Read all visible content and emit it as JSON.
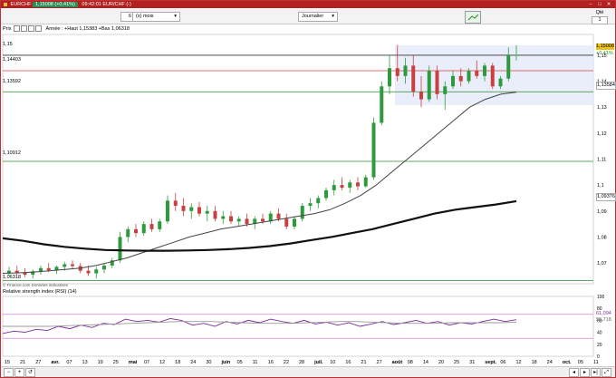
{
  "titlebar": {
    "symbol": "EURCHF",
    "change": "1,15008 (+0,41%)",
    "time_instrument": "09:42:01 EUR/CHF (-)",
    "min_btn": "–",
    "max_btn": "□",
    "close_btn": "✕"
  },
  "toolbar": {
    "period_value": "6",
    "period_unit": "(x) mois",
    "interval": "Journalier",
    "qte_label": "Qté",
    "qte_value": "1"
  },
  "main_panel": {
    "label": "Prix",
    "ohlc_text": "Année : +Haut 1,15383 +Bas 1,06318",
    "level_labels": [
      "1,15",
      "1,14403",
      "1,13592",
      "1,10912",
      "1,06318"
    ],
    "level_line_color": "#2e8b2e",
    "level_line_color_red": "#d04040",
    "up_color": "#2e9a3e",
    "down_color": "#c84040",
    "last_price_tag": "1,15008",
    "last_change_tag": "+0,41%",
    "tag_113584": "1,13584",
    "tag_109376": "1,09376",
    "credit": "© Finance.com Données indicatives"
  },
  "rsi_panel": {
    "label": "Relative strength index (RSI) (14)",
    "rsi_tag": "61,094",
    "signal_tag": "56,718",
    "rsi_color": "#7a2a9a",
    "signal_color": "#999999"
  },
  "chart_data": {
    "type": "candlestick",
    "symbol": "EUR/CHF",
    "x_tick_labels": [
      "15",
      "21",
      "27",
      "avr.",
      "07",
      "13",
      "19",
      "25",
      "mai",
      "07",
      "12",
      "18",
      "24",
      "30",
      "juin",
      "05",
      "11",
      "16",
      "22",
      "28",
      "juil.",
      "10",
      "16",
      "21",
      "27",
      "août",
      "08",
      "14",
      "20",
      "25",
      "31",
      "sept.",
      "06",
      "12",
      "18",
      "24",
      "oct.",
      "05",
      "11"
    ],
    "y_ticks": [
      "1,15",
      "1,14",
      "1,13",
      "1,12",
      "1,11",
      "1,1",
      "1,09",
      "1,08",
      "1,07"
    ],
    "rsi_ticks": [
      "100",
      "80",
      "60",
      "40",
      "20",
      "0"
    ],
    "ylim": [
      1.062,
      1.158
    ],
    "candles": [
      [
        1.066,
        1.0685,
        1.065,
        1.067
      ],
      [
        1.067,
        1.069,
        1.0655,
        1.0662
      ],
      [
        1.0662,
        1.068,
        1.0645,
        1.0655
      ],
      [
        1.0655,
        1.0675,
        1.064,
        1.0668
      ],
      [
        1.0668,
        1.069,
        1.0655,
        1.068
      ],
      [
        1.068,
        1.07,
        1.0665,
        1.0672
      ],
      [
        1.0672,
        1.069,
        1.0658,
        1.0685
      ],
      [
        1.0685,
        1.0705,
        1.067,
        1.0695
      ],
      [
        1.0695,
        1.071,
        1.0675,
        1.0688
      ],
      [
        1.0688,
        1.07,
        1.066,
        1.067
      ],
      [
        1.067,
        1.069,
        1.065,
        1.066
      ],
      [
        1.066,
        1.0685,
        1.064,
        1.0675
      ],
      [
        1.0675,
        1.07,
        1.066,
        1.069
      ],
      [
        1.069,
        1.072,
        1.068,
        1.071
      ],
      [
        1.071,
        1.082,
        1.07,
        1.08
      ],
      [
        1.08,
        1.084,
        1.078,
        1.083
      ],
      [
        1.083,
        1.085,
        1.08,
        1.0815
      ],
      [
        1.0815,
        1.086,
        1.0805,
        1.085
      ],
      [
        1.085,
        1.087,
        1.082,
        1.083
      ],
      [
        1.083,
        1.087,
        1.082,
        1.086
      ],
      [
        1.086,
        1.096,
        1.085,
        1.094
      ],
      [
        1.094,
        1.097,
        1.09,
        1.092
      ],
      [
        1.092,
        1.095,
        1.088,
        1.09
      ],
      [
        1.09,
        1.093,
        1.087,
        1.0915
      ],
      [
        1.0915,
        1.0935,
        1.088,
        1.089
      ],
      [
        1.089,
        1.092,
        1.086,
        1.09
      ],
      [
        1.09,
        1.092,
        1.086,
        1.087
      ],
      [
        1.087,
        1.09,
        1.085,
        1.088
      ],
      [
        1.088,
        1.09,
        1.085,
        1.086
      ],
      [
        1.086,
        1.088,
        1.084,
        1.087
      ],
      [
        1.087,
        1.089,
        1.084,
        1.085
      ],
      [
        1.085,
        1.088,
        1.083,
        1.087
      ],
      [
        1.087,
        1.089,
        1.085,
        1.086
      ],
      [
        1.086,
        1.09,
        1.085,
        1.089
      ],
      [
        1.089,
        1.091,
        1.086,
        1.087
      ],
      [
        1.087,
        1.089,
        1.083,
        1.084
      ],
      [
        1.084,
        1.088,
        1.083,
        1.087
      ],
      [
        1.087,
        1.093,
        1.086,
        1.092
      ],
      [
        1.092,
        1.095,
        1.09,
        1.093
      ],
      [
        1.093,
        1.096,
        1.091,
        1.095
      ],
      [
        1.095,
        1.099,
        1.094,
        1.098
      ],
      [
        1.098,
        1.102,
        1.096,
        1.1
      ],
      [
        1.1,
        1.103,
        1.098,
        1.099
      ],
      [
        1.099,
        1.102,
        1.097,
        1.101
      ],
      [
        1.101,
        1.103,
        1.098,
        1.0995
      ],
      [
        1.0995,
        1.104,
        1.099,
        1.103
      ],
      [
        1.103,
        1.126,
        1.102,
        1.124
      ],
      [
        1.124,
        1.14,
        1.123,
        1.138
      ],
      [
        1.138,
        1.15,
        1.135,
        1.145
      ],
      [
        1.145,
        1.154,
        1.14,
        1.142
      ],
      [
        1.142,
        1.149,
        1.139,
        1.146
      ],
      [
        1.146,
        1.15,
        1.134,
        1.136
      ],
      [
        1.136,
        1.142,
        1.13,
        1.133
      ],
      [
        1.133,
        1.146,
        1.132,
        1.144
      ],
      [
        1.144,
        1.146,
        1.133,
        1.135
      ],
      [
        1.135,
        1.14,
        1.129,
        1.138
      ],
      [
        1.138,
        1.144,
        1.137,
        1.142
      ],
      [
        1.142,
        1.145,
        1.138,
        1.14
      ],
      [
        1.14,
        1.145,
        1.139,
        1.144
      ],
      [
        1.144,
        1.148,
        1.141,
        1.142
      ],
      [
        1.142,
        1.147,
        1.14,
        1.146
      ],
      [
        1.146,
        1.147,
        1.137,
        1.138
      ],
      [
        1.138,
        1.142,
        1.137,
        1.141
      ],
      [
        1.141,
        1.153,
        1.14,
        1.15
      ],
      [
        1.15,
        1.1538,
        1.148,
        1.1501
      ]
    ],
    "moving_averages": [
      {
        "color": "#444444",
        "width": 1,
        "values": [
          1.066,
          1.0662,
          1.0665,
          1.067,
          1.0675,
          1.068,
          1.069,
          1.0705,
          1.072,
          1.074,
          1.076,
          1.078,
          1.08,
          1.0815,
          1.083,
          1.084,
          1.085,
          1.086,
          1.087,
          1.088,
          1.089,
          1.0905,
          1.093,
          1.096,
          1.1,
          1.105,
          1.11,
          1.115,
          1.12,
          1.125,
          1.13,
          1.133,
          1.135,
          1.1358
        ]
      },
      {
        "color": "#111111",
        "width": 2.2,
        "values": [
          1.0795,
          1.0785,
          1.0772,
          1.0762,
          1.0755,
          1.075,
          1.0748,
          1.0747,
          1.0747,
          1.0748,
          1.075,
          1.0753,
          1.0758,
          1.0765,
          1.0775,
          1.0788,
          1.08,
          1.0815,
          1.083,
          1.085,
          1.087,
          1.089,
          1.0905,
          1.0915,
          1.0925,
          1.0938
        ]
      }
    ],
    "horizontal_levels": [
      1.15,
      1.14403,
      1.13592,
      1.10912,
      1.06318
    ],
    "rsi": [
      38,
      42,
      40,
      45,
      43,
      50,
      46,
      52,
      48,
      55,
      53,
      62,
      58,
      60,
      57,
      63,
      60,
      52,
      55,
      50,
      58,
      54,
      60,
      56,
      62,
      58,
      55,
      60,
      54,
      57,
      52,
      56,
      50,
      54,
      58,
      53,
      56,
      60,
      55,
      58,
      52,
      56,
      54,
      58,
      62,
      58,
      61
    ],
    "rsi_signal": [
      50,
      50,
      50,
      50,
      51,
      52,
      53,
      54,
      55,
      56,
      57,
      58,
      58,
      58,
      57,
      56,
      55,
      55,
      55,
      56,
      57,
      58,
      58,
      57,
      56,
      55,
      55,
      55,
      56,
      56,
      56,
      56,
      57
    ]
  }
}
